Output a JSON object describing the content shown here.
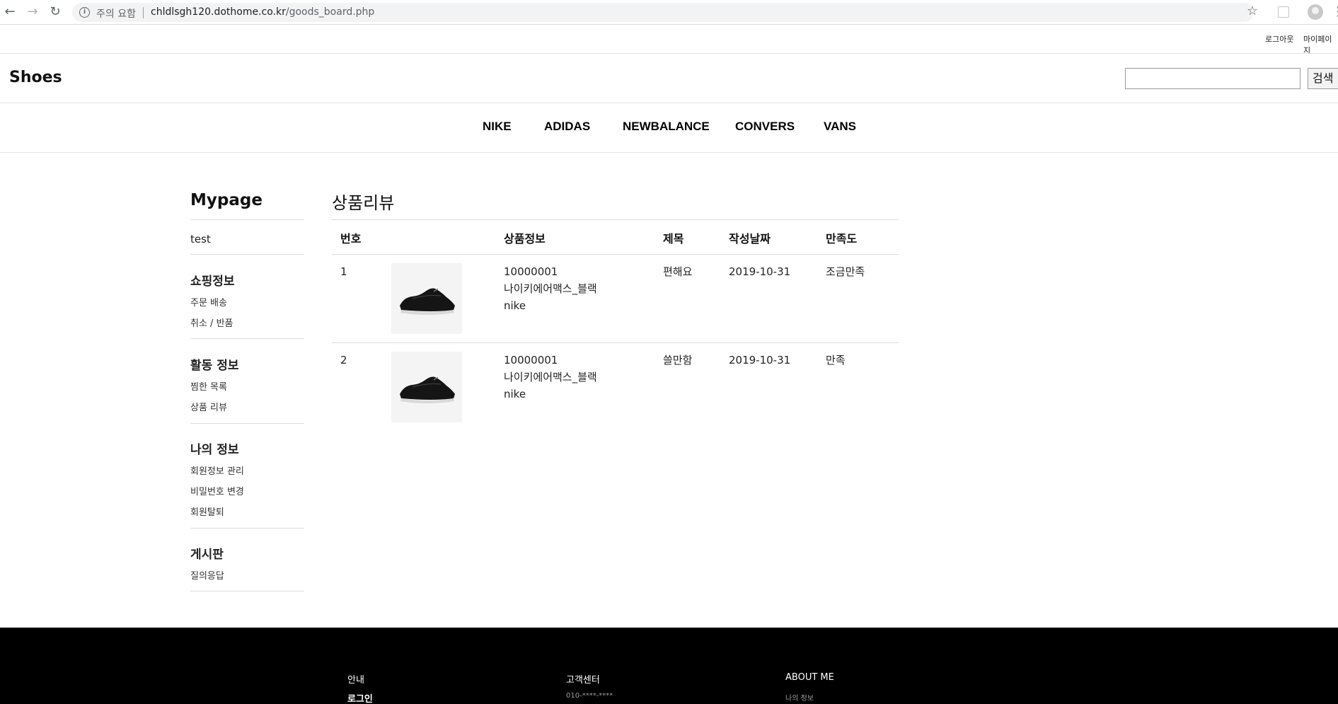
{
  "browser": {
    "warning": "주의 요함",
    "url_host": "chldlsgh120.dothome.co.kr",
    "url_path": "/goods_board.php"
  },
  "util": {
    "logout": "로그아웃",
    "mypage": "마이페이지"
  },
  "header": {
    "logo": "Shoes",
    "search_button": "검색",
    "search_value": ""
  },
  "brands": [
    "NIKE",
    "ADIDAS",
    "NEWBALANCE",
    "CONVERS",
    "VANS"
  ],
  "sidebar": {
    "title": "Mypage",
    "user": "test",
    "sections": [
      {
        "heading": "쇼핑정보",
        "links": [
          "주문 배송",
          "취소 / 반품"
        ]
      },
      {
        "heading": "활동 정보",
        "links": [
          "찜한 목록",
          "상품 리뷰"
        ]
      },
      {
        "heading": "나의 정보",
        "links": [
          "회원정보 관리",
          "비밀번호 변경",
          "회원탈퇴"
        ]
      },
      {
        "heading": "게시판",
        "links": [
          "질의응답"
        ]
      }
    ]
  },
  "main": {
    "title": "상품리뷰",
    "columns": [
      "번호",
      "상품정보",
      "제목",
      "작성날짜",
      "만족도"
    ],
    "rows": [
      {
        "no": "1",
        "code": "10000001",
        "name": "나이키에어맥스_블랙",
        "brand": "nike",
        "subject": "편해요",
        "date": "2019-10-31",
        "rating": "조금만족"
      },
      {
        "no": "2",
        "code": "10000001",
        "name": "나이키에어맥스_블랙",
        "brand": "nike",
        "subject": "쓸만함",
        "date": "2019-10-31",
        "rating": "만족"
      }
    ]
  },
  "footer": {
    "col1": {
      "heading": "안내",
      "sub": "로그인"
    },
    "col2": {
      "heading": "고객센터",
      "sub": "010-****-****"
    },
    "col3": {
      "heading": "ABOUT ME",
      "sub": "나의 정보"
    }
  }
}
